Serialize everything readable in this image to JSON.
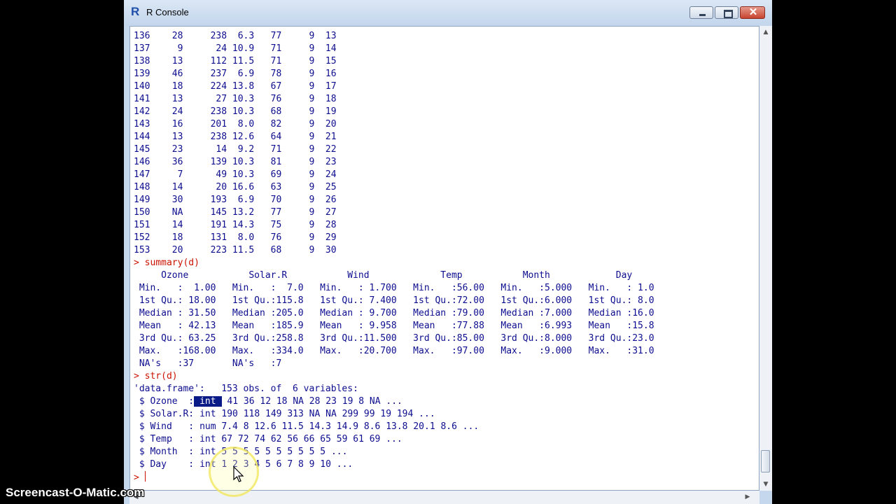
{
  "window": {
    "title": "R Console",
    "close_glyph": "✕",
    "icon": "r-logo-icon",
    "icon_text": "R"
  },
  "console": {
    "data_rows": [
      "136    28     238  6.3   77     9  13",
      "137     9      24 10.9   71     9  14",
      "138    13     112 11.5   71     9  15",
      "139    46     237  6.9   78     9  16",
      "140    18     224 13.8   67     9  17",
      "141    13      27 10.3   76     9  18",
      "142    24     238 10.3   68     9  19",
      "143    16     201  8.0   82     9  20",
      "144    13     238 12.6   64     9  21",
      "145    23      14  9.2   71     9  22",
      "146    36     139 10.3   81     9  23",
      "147     7      49 10.3   69     9  24",
      "148    14      20 16.6   63     9  25",
      "149    30     193  6.9   70     9  26",
      "150    NA     145 13.2   77     9  27",
      "151    14     191 14.3   75     9  28",
      "152    18     131  8.0   76     9  29",
      "153    20     223 11.5   68     9  30"
    ],
    "summary_cmd": "> summary(d)",
    "summary_rows": [
      "     Ozone           Solar.R           Wind             Temp           Month            Day      ",
      " Min.   :  1.00   Min.   :  7.0   Min.   : 1.700   Min.   :56.00   Min.   :5.000   Min.   : 1.0  ",
      " 1st Qu.: 18.00   1st Qu.:115.8   1st Qu.: 7.400   1st Qu.:72.00   1st Qu.:6.000   1st Qu.: 8.0  ",
      " Median : 31.50   Median :205.0   Median : 9.700   Median :79.00   Median :7.000   Median :16.0  ",
      " Mean   : 42.13   Mean   :185.9   Mean   : 9.958   Mean   :77.88   Mean   :6.993   Mean   :15.8  ",
      " 3rd Qu.: 63.25   3rd Qu.:258.8   3rd Qu.:11.500   3rd Qu.:85.00   3rd Qu.:8.000   3rd Qu.:23.0  ",
      " Max.   :168.00   Max.   :334.0   Max.   :20.700   Max.   :97.00   Max.   :9.000   Max.   :31.0  ",
      " NA's   :37       NA's   :7                                                                       "
    ],
    "str_cmd": "> str(d)",
    "str_header": "'data.frame':   153 obs. of  6 variables:",
    "str_rows": [
      {
        "name": " $ Ozone  :",
        "type": "int",
        "values": " 41 36 12 18 NA 28 23 19 8 NA ..."
      },
      {
        "name": " $ Solar.R:",
        "type": "int",
        "values": " 190 118 149 313 NA NA 299 99 19 194 ..."
      },
      {
        "name": " $ Wind   :",
        "type": "num",
        "values": " 7.4 8 12.6 11.5 14.3 14.9 8.6 13.8 20.1 8.6 ..."
      },
      {
        "name": " $ Temp   :",
        "type": "int",
        "values": " 67 72 74 62 56 66 65 59 61 69 ..."
      },
      {
        "name": " $ Month  :",
        "type": "int",
        "values": " 5 5 5 5 5 5 5 5 5 5 ..."
      },
      {
        "name": " $ Day    :",
        "type": "int",
        "values": " 1 2 3 4 5 6 7 8 9 10 ..."
      }
    ],
    "prompt": "> "
  },
  "scrollbar": {
    "up": "▲",
    "down": "▼",
    "left": "◀",
    "right": "▶"
  },
  "watermark": "Screencast-O-Matic.com",
  "colors": {
    "output": "#0d0d8f",
    "command": "#cc1100",
    "highlight": "#0a1a86"
  }
}
